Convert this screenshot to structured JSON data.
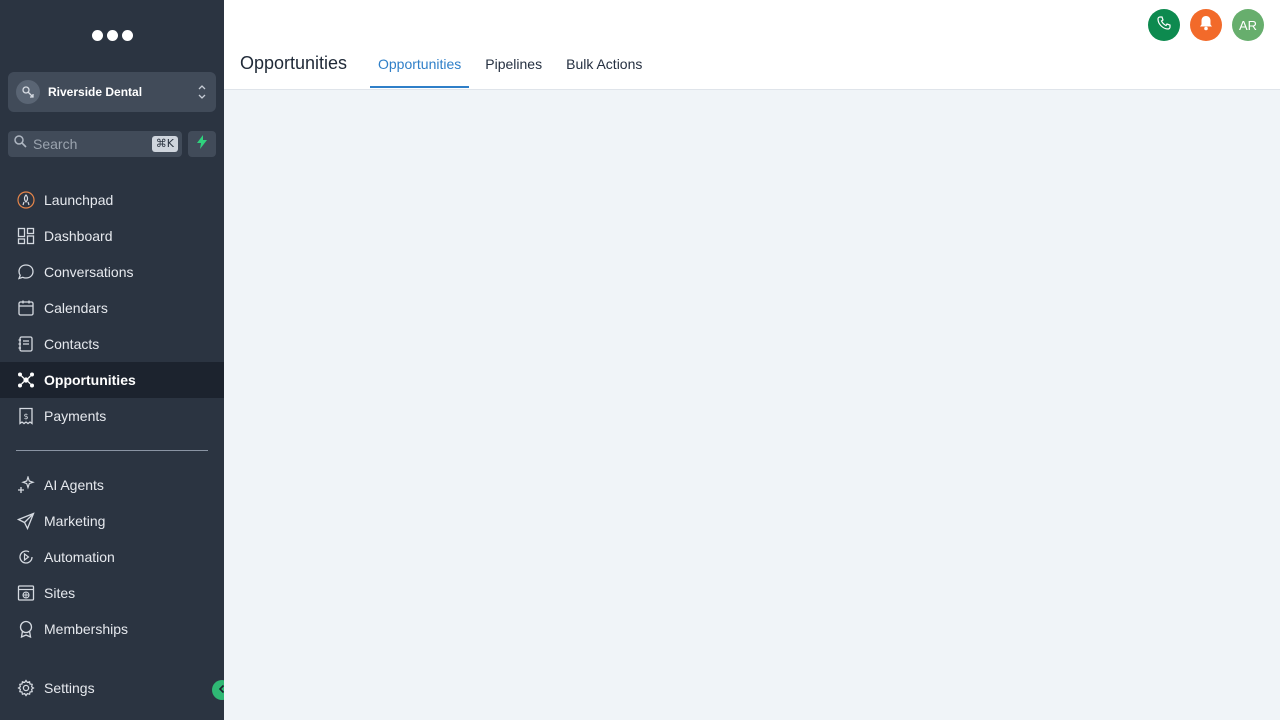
{
  "sidebar": {
    "account_name": "Riverside Dental",
    "search_placeholder": "Search",
    "search_shortcut": "⌘K",
    "items": [
      {
        "label": "Launchpad",
        "icon": "launchpad-icon"
      },
      {
        "label": "Dashboard",
        "icon": "dashboard-icon"
      },
      {
        "label": "Conversations",
        "icon": "chat-bubble-icon"
      },
      {
        "label": "Calendars",
        "icon": "calendar-icon"
      },
      {
        "label": "Contacts",
        "icon": "contacts-book-icon"
      },
      {
        "label": "Opportunities",
        "icon": "opportunities-icon",
        "active": true
      },
      {
        "label": "Payments",
        "icon": "payments-icon"
      }
    ],
    "items2": [
      {
        "label": "AI Agents",
        "icon": "sparkles-icon"
      },
      {
        "label": "Marketing",
        "icon": "send-icon"
      },
      {
        "label": "Automation",
        "icon": "automation-icon"
      },
      {
        "label": "Sites",
        "icon": "sites-icon"
      },
      {
        "label": "Memberships",
        "icon": "badge-icon"
      }
    ],
    "settings_label": "Settings"
  },
  "header": {
    "title": "Opportunities",
    "tabs": [
      {
        "label": "Opportunities",
        "active": true
      },
      {
        "label": "Pipelines"
      },
      {
        "label": "Bulk Actions"
      }
    ],
    "avatar_initials": "AR"
  },
  "colors": {
    "sidebar_bg": "#2b3441",
    "active_tab": "#2f7fc8",
    "phone": "#0d8a4f",
    "bell": "#f26a2a",
    "avatar": "#67ae6d",
    "accent_green": "#2fb874"
  }
}
